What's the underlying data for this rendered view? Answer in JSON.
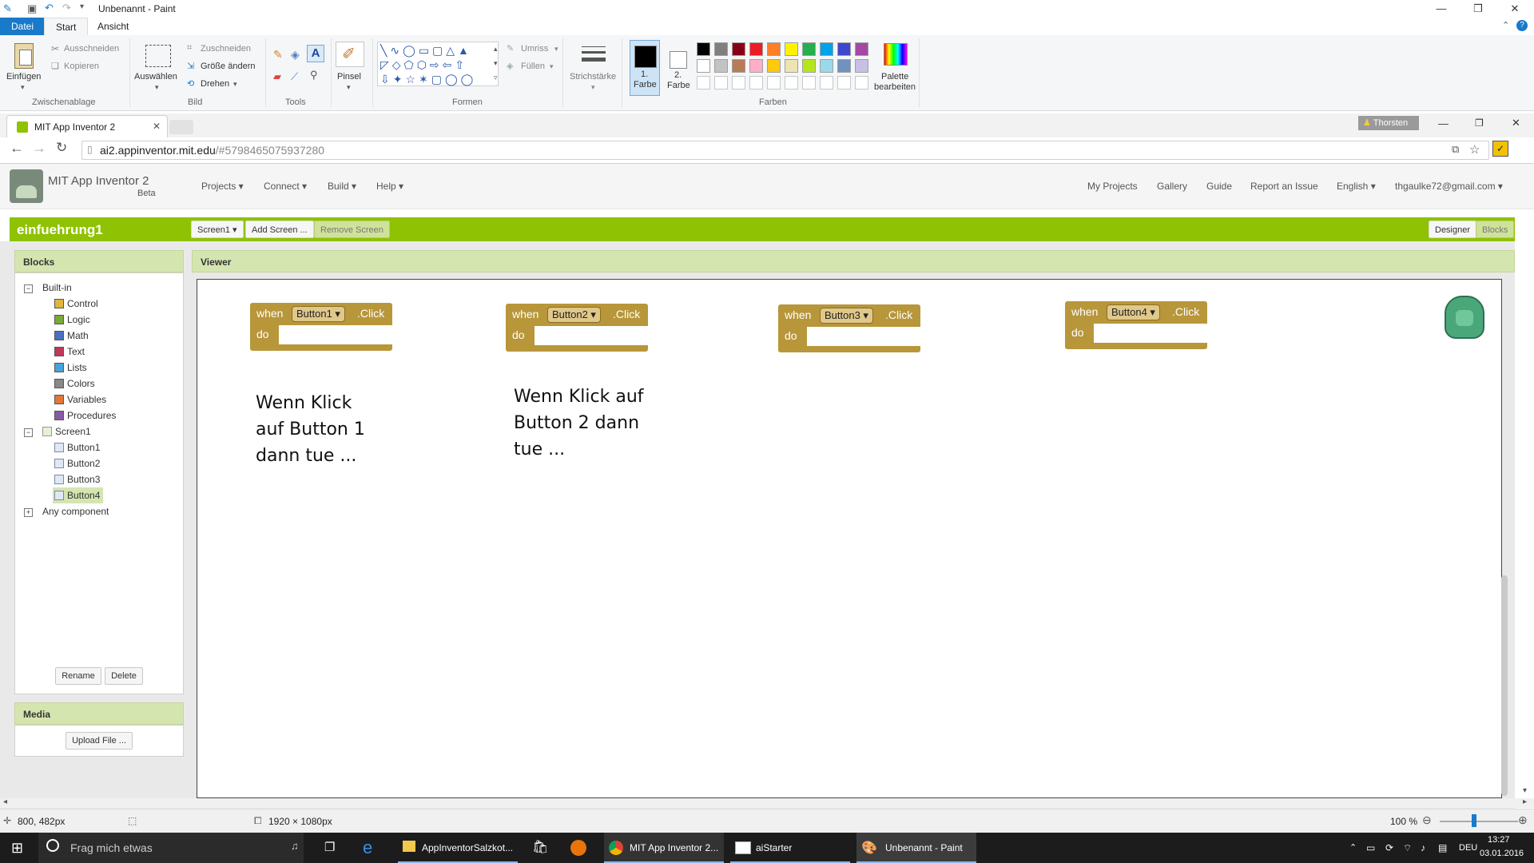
{
  "paint": {
    "window_title": "Unbenannt - Paint",
    "tabs": [
      "Datei",
      "Start",
      "Ansicht"
    ],
    "clipboard": {
      "paste": "Einfügen",
      "cut": "Ausschneiden",
      "copy": "Kopieren",
      "group": "Zwischenablage"
    },
    "image": {
      "select": "Auswählen",
      "crop": "Zuschneiden",
      "resize": "Größe ändern",
      "rotate": "Drehen",
      "group": "Bild"
    },
    "tools": {
      "group": "Tools",
      "brush": "Pinsel"
    },
    "shapes": {
      "outline": "Umriss",
      "fill": "Füllen",
      "group": "Formen"
    },
    "stroke": {
      "label": "Strichstärke"
    },
    "colors": {
      "color1_line1": "1.",
      "color1_line2": "Farbe",
      "color2_line1": "2.",
      "color2_line2": "Farbe",
      "group": "Farben",
      "edit_line1": "Palette",
      "edit_line2": "bearbeiten",
      "palette_row1": [
        "#000000",
        "#7f7f7f",
        "#880015",
        "#ed1c24",
        "#ff7f27",
        "#fff200",
        "#22b14c",
        "#00a2e8",
        "#3f48cc",
        "#a349a4"
      ],
      "palette_row2": [
        "#ffffff",
        "#c3c3c3",
        "#b97a57",
        "#ffaec9",
        "#ffc90e",
        "#efe4b0",
        "#b5e61d",
        "#99d9ea",
        "#7092be",
        "#c8bfe7"
      ]
    },
    "status": {
      "cursor": "800, 482px",
      "size": "1920 × 1080px",
      "zoom": "100 %"
    }
  },
  "browser": {
    "tab_title": "MIT App Inventor 2",
    "profile": "Thorsten",
    "url_host": "ai2.appinventor.mit.edu",
    "url_rest": "/#5798465075937280"
  },
  "appinventor": {
    "title": "MIT App Inventor 2",
    "subtitle": "Beta",
    "menu": [
      "Projects ▾",
      "Connect ▾",
      "Build ▾",
      "Help ▾"
    ],
    "right_menu": [
      "My Projects",
      "Gallery",
      "Guide",
      "Report an Issue",
      "English ▾",
      "thgaulke72@gmail.com ▾"
    ],
    "project_name": "einfuehrung1",
    "screen_dropdown": "Screen1 ▾",
    "add_screen": "Add Screen ...",
    "remove_screen": "Remove Screen",
    "designer": "Designer",
    "blocks_btn": "Blocks",
    "blocks_panel": {
      "header": "Blocks",
      "builtin": "Built-in",
      "builtin_items": [
        {
          "label": "Control",
          "color": "#e0b53a"
        },
        {
          "label": "Logic",
          "color": "#7ca83a"
        },
        {
          "label": "Math",
          "color": "#4a6fc4"
        },
        {
          "label": "Text",
          "color": "#c2365a"
        },
        {
          "label": "Lists",
          "color": "#4aa3d8"
        },
        {
          "label": "Colors",
          "color": "#888888"
        },
        {
          "label": "Variables",
          "color": "#e0783a"
        },
        {
          "label": "Procedures",
          "color": "#8a5aa4"
        }
      ],
      "screen": "Screen1",
      "screen_items": [
        "Button1",
        "Button2",
        "Button3",
        "Button4"
      ],
      "any_component": "Any component",
      "rename": "Rename",
      "delete": "Delete"
    },
    "media": {
      "header": "Media",
      "upload": "Upload File ..."
    },
    "viewer": {
      "header": "Viewer",
      "blocks": [
        {
          "when": "when",
          "component": "Button1 ▾",
          "event": ".Click",
          "do": "do"
        },
        {
          "when": "when",
          "component": "Button2 ▾",
          "event": ".Click",
          "do": "do"
        },
        {
          "when": "when",
          "component": "Button3 ▾",
          "event": ".Click",
          "do": "do"
        },
        {
          "when": "when",
          "component": "Button4 ▾",
          "event": ".Click",
          "do": "do"
        }
      ],
      "notes": [
        "Wenn Klick\nauf Button 1\ndann tue ...",
        "Wenn Klick auf\nButton 2 dann\ntue ..."
      ]
    }
  },
  "taskbar": {
    "search": "Frag mich etwas",
    "apps": [
      "AppInventorSalzkot...",
      "MIT App Inventor 2...",
      "aiStarter",
      "Unbenannt - Paint"
    ],
    "lang": "DEU",
    "time": "13:27",
    "date": "03.01.2016"
  }
}
